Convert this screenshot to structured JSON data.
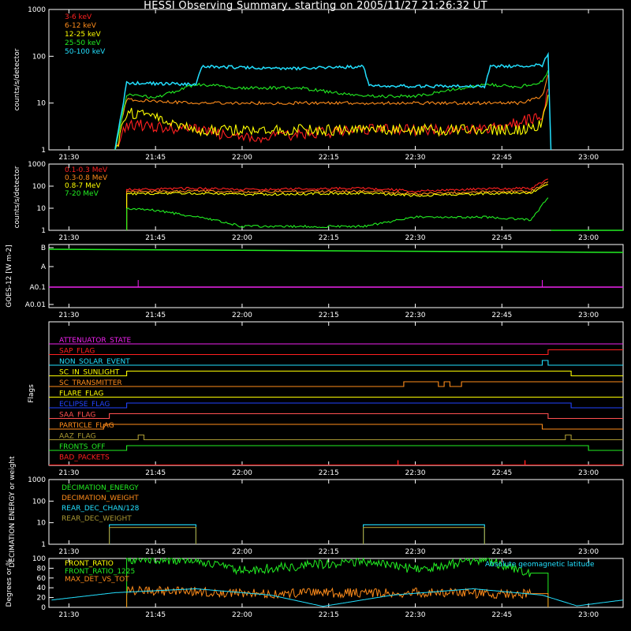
{
  "title": "HESSI Observing Summary, starting on 2005/11/27 21:26:32 UT",
  "time_ticks": [
    "21:30",
    "21:45",
    "22:00",
    "22:15",
    "22:30",
    "22:45",
    "23:00"
  ],
  "colors": {
    "red": "#ff2020",
    "orange": "#ff8c1a",
    "yellow": "#ffff00",
    "green": "#22ee22",
    "cyan": "#22e0ff",
    "magenta": "#ee22ee",
    "blue": "#2244ff",
    "olive": "#aa9933",
    "salmon": "#ff5050",
    "white": "#ffffff"
  },
  "chart_data": [
    {
      "type": "line",
      "ylabel": "counts/s/detector",
      "yscale": "log",
      "ylim": [
        1,
        1000
      ],
      "ytick_labels": [
        "1",
        "10",
        "100",
        "1000"
      ],
      "xlim": [
        "21:26:32",
        "23:06"
      ],
      "series": [
        {
          "name": "3-6 keV",
          "color": "red",
          "x": [
            "21:38",
            "21:40",
            "21:52",
            "22:00",
            "22:21",
            "22:30",
            "22:42",
            "22:47",
            "22:52",
            "22:53"
          ],
          "y": [
            1,
            4,
            3,
            2,
            3,
            3,
            3,
            4,
            6,
            20
          ]
        },
        {
          "name": "6-12 keV",
          "color": "orange",
          "x": [
            "21:38",
            "21:40",
            "21:45",
            "21:52",
            "22:00",
            "22:10",
            "22:21",
            "22:30",
            "22:42",
            "22:48",
            "22:52",
            "22:53"
          ],
          "y": [
            1,
            12,
            11,
            10,
            10,
            10,
            10,
            10,
            10,
            10,
            14,
            40
          ]
        },
        {
          "name": "12-25 keV",
          "color": "yellow",
          "x": [
            "21:38",
            "21:40",
            "21:45",
            "21:52",
            "22:00",
            "22:21",
            "22:30",
            "22:42",
            "22:48",
            "22:52",
            "22:53"
          ],
          "y": [
            1,
            7,
            6,
            3,
            3,
            3,
            3,
            3,
            3,
            4,
            15
          ]
        },
        {
          "name": "25-50 keV",
          "color": "green",
          "x": [
            "21:38",
            "21:40",
            "21:45",
            "21:52",
            "22:00",
            "22:10",
            "22:21",
            "22:30",
            "22:42",
            "22:48",
            "22:52",
            "22:53"
          ],
          "y": [
            1,
            15,
            13,
            25,
            21,
            21,
            14,
            14,
            25,
            22,
            28,
            50
          ]
        },
        {
          "name": "50-100 keV",
          "color": "cyan",
          "x": [
            "21:38",
            "21:40",
            "21:52",
            "21:53",
            "22:10",
            "22:21",
            "22:22",
            "22:42",
            "22:43",
            "22:52",
            "22:53",
            "22:53.5"
          ],
          "y": [
            1,
            27,
            25,
            60,
            55,
            60,
            23,
            23,
            60,
            65,
            110,
            1
          ]
        }
      ]
    },
    {
      "type": "line",
      "ylabel": "counts/s/detector",
      "yscale": "log",
      "ylim": [
        1,
        1000
      ],
      "ytick_labels": [
        "1",
        "10",
        "100",
        "1000"
      ],
      "xlim": [
        "21:26:32",
        "23:06"
      ],
      "series": [
        {
          "name": "0.1-0.3 MeV",
          "color": "red",
          "x": [
            "21:40",
            "21:52",
            "22:00",
            "22:21",
            "22:30",
            "22:42",
            "22:50",
            "22:53"
          ],
          "y": [
            70,
            80,
            70,
            80,
            60,
            75,
            80,
            210
          ]
        },
        {
          "name": "0.3-0.8 MeV",
          "color": "orange",
          "x": [
            "21:40",
            "21:52",
            "22:00",
            "22:21",
            "22:30",
            "22:42",
            "22:50",
            "22:53"
          ],
          "y": [
            55,
            60,
            55,
            60,
            45,
            55,
            60,
            160
          ]
        },
        {
          "name": "0.8-7 MeV",
          "color": "yellow",
          "x": [
            "21:40",
            "21:52",
            "22:00",
            "22:21",
            "22:30",
            "22:42",
            "22:50",
            "22:53"
          ],
          "y": [
            45,
            48,
            42,
            48,
            38,
            45,
            50,
            120
          ]
        },
        {
          "name": "7-20 MeV",
          "color": "green",
          "x": [
            "21:40",
            "21:45",
            "21:55",
            "22:00",
            "22:21",
            "22:30",
            "22:42",
            "22:50",
            "22:53"
          ],
          "y": [
            10,
            8,
            3,
            1.5,
            1.5,
            4,
            4,
            3,
            30
          ]
        }
      ]
    },
    {
      "type": "line",
      "ylabel": "GOES-12 [W m-2]",
      "ytick_labels": [
        "A0.01",
        "A0.1",
        "A",
        "B"
      ],
      "xlim": [
        "21:26:32",
        "23:06"
      ],
      "series": [
        {
          "color": "green",
          "x": [
            "21:27",
            "21:35",
            "21:40",
            "22:20",
            "22:40",
            "23:06"
          ],
          "y": [
            "B",
            "B",
            "B",
            "B",
            "B",
            "B"
          ]
        },
        {
          "color": "magenta",
          "x": [
            "21:27",
            "23:06"
          ],
          "y": [
            "A0.1",
            "A0.1"
          ]
        }
      ]
    },
    {
      "type": "line",
      "ylabel": "Flags",
      "xlim": [
        "21:26:32",
        "23:06"
      ],
      "series": [
        {
          "name": "ATTENUATOR_STATE",
          "color": "magenta",
          "transitions": []
        },
        {
          "name": "SAP_FLAG",
          "color": "red",
          "transitions": [
            "22:53"
          ]
        },
        {
          "name": "NON_SOLAR_EVENT",
          "color": "cyan",
          "transitions": [
            "22:52",
            "22:53"
          ]
        },
        {
          "name": "SC_IN_SUNLIGHT",
          "color": "yellow",
          "transitions": [
            "21:40",
            "22:57"
          ]
        },
        {
          "name": "SC_TRANSMITTER",
          "color": "orange",
          "transitions": [
            "22:28",
            "22:34",
            "22:35",
            "22:36",
            "22:38"
          ]
        },
        {
          "name": "FLARE_FLAG",
          "color": "yellow",
          "transitions": []
        },
        {
          "name": "ECLIPSE_FLAG",
          "color": "blue",
          "transitions": [
            "21:40",
            "22:57"
          ]
        },
        {
          "name": "SAA_FLAG",
          "color": "salmon",
          "transitions": [
            "21:37",
            "22:53"
          ]
        },
        {
          "name": "PARTICLE_FLAG",
          "color": "orange",
          "transitions": [
            "21:36",
            "22:52"
          ]
        },
        {
          "name": "AAZ_FLAG",
          "color": "olive",
          "transitions": [
            "21:42",
            "21:43",
            "22:56",
            "22:57"
          ]
        },
        {
          "name": "FRONTS_OFF",
          "color": "green",
          "transitions": [
            "21:40",
            "23:00"
          ]
        },
        {
          "name": "BAD_PACKETS",
          "color": "red",
          "spikes": [
            "22:27",
            "22:49"
          ]
        }
      ]
    },
    {
      "type": "line",
      "ylabel": "DECIMATION ENERGY or weight",
      "yscale": "log",
      "ylim": [
        1,
        1000
      ],
      "ytick_labels": [
        "1",
        "10",
        "100",
        "1000"
      ],
      "xlim": [
        "21:26:32",
        "23:06"
      ],
      "series": [
        {
          "name": "DECIMATION_ENERGY",
          "color": "green",
          "x": [],
          "y": []
        },
        {
          "name": "DECIMATION_WEIGHT",
          "color": "orange",
          "x": [],
          "y": []
        },
        {
          "name": "REAR_DEC_CHAN/128",
          "color": "cyan",
          "x": [
            "21:37",
            "21:52",
            "22:21",
            "22:42"
          ],
          "y": [
            8,
            8,
            8,
            8
          ],
          "segments": [
            [
              "21:37",
              "21:52"
            ],
            [
              "22:21",
              "22:42"
            ]
          ]
        },
        {
          "name": "REAR_DEC_WEIGHT",
          "color": "olive",
          "x": [
            "21:37",
            "21:52",
            "22:21",
            "22:42"
          ],
          "y": [
            6,
            6,
            6,
            6
          ],
          "segments": [
            [
              "21:37",
              "21:52"
            ],
            [
              "22:21",
              "22:42"
            ]
          ]
        }
      ]
    },
    {
      "type": "line",
      "ylabel": "Degrees or %",
      "ylim": [
        0,
        100
      ],
      "ytick_labels": [
        "0",
        "20",
        "40",
        "60",
        "80",
        "100"
      ],
      "xlim": [
        "21:26:32",
        "23:06"
      ],
      "series": [
        {
          "name": "FRONT_RATIO",
          "color": "yellow",
          "x": [],
          "y": []
        },
        {
          "name": "FRONT_RATIO_1225",
          "color": "green",
          "x": [
            "21:40",
            "21:52",
            "22:00",
            "22:21",
            "22:30",
            "22:42",
            "22:50",
            "22:53"
          ],
          "y": [
            97,
            98,
            75,
            95,
            78,
            97,
            70,
            0
          ]
        },
        {
          "name": "MAX_DET_VS_TOT",
          "color": "orange",
          "x": [
            "21:40",
            "21:52",
            "22:00",
            "22:21",
            "22:30",
            "22:42",
            "22:50",
            "22:53"
          ],
          "y": [
            33,
            33,
            28,
            30,
            30,
            28,
            28,
            0
          ]
        },
        {
          "name": "Absolute geomagnetic latitude",
          "color": "cyan",
          "x": [
            "21:27",
            "21:38",
            "21:52",
            "22:05",
            "22:14",
            "22:26",
            "22:40",
            "22:52",
            "22:58",
            "23:06"
          ],
          "y": [
            15,
            30,
            38,
            25,
            2,
            25,
            38,
            25,
            3,
            15
          ]
        }
      ]
    }
  ]
}
